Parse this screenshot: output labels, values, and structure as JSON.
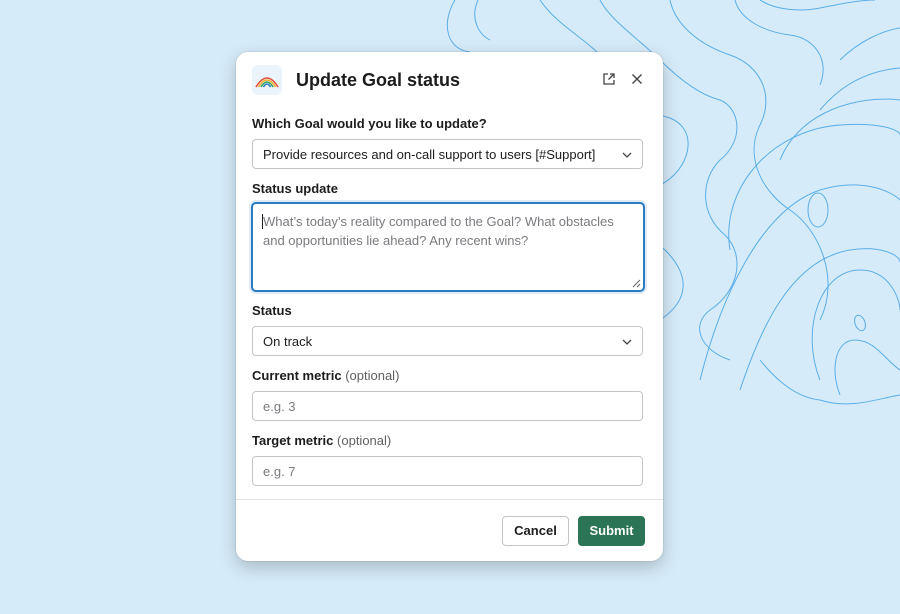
{
  "modal": {
    "title": "Update Goal status",
    "icons": {
      "app": "rainbow-app-icon",
      "open_external": "external-link-icon",
      "close": "close-icon"
    }
  },
  "goal": {
    "label": "Which Goal would you like to update?",
    "selected": "Provide resources and on-call support to users [#Support]"
  },
  "status_update": {
    "label": "Status update",
    "placeholder": "What’s today’s reality compared to the Goal? What obstacles and opportunities lie ahead? Any recent wins?"
  },
  "status": {
    "label": "Status",
    "selected": "On track"
  },
  "current_metric": {
    "label": "Current metric",
    "optional": "(optional)",
    "placeholder": "e.g. 3"
  },
  "target_metric": {
    "label": "Target metric",
    "optional": "(optional)",
    "placeholder": "e.g. 7"
  },
  "footer": {
    "cancel_label": "Cancel",
    "submit_label": "Submit"
  },
  "colors": {
    "background": "#d6ebf9",
    "contour_lines": "#5aaee8",
    "focus_border": "#2a7bc2",
    "submit_button": "#2b7456"
  }
}
